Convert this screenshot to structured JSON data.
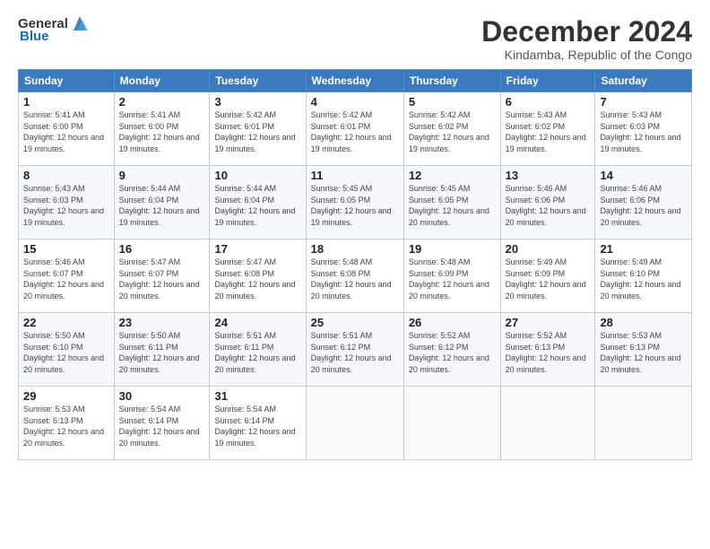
{
  "logo": {
    "general": "General",
    "blue": "Blue"
  },
  "title": "December 2024",
  "location": "Kindamba, Republic of the Congo",
  "days_of_week": [
    "Sunday",
    "Monday",
    "Tuesday",
    "Wednesday",
    "Thursday",
    "Friday",
    "Saturday"
  ],
  "weeks": [
    [
      {
        "day": "1",
        "sunrise": "Sunrise: 5:41 AM",
        "sunset": "Sunset: 6:00 PM",
        "daylight": "Daylight: 12 hours and 19 minutes."
      },
      {
        "day": "2",
        "sunrise": "Sunrise: 5:41 AM",
        "sunset": "Sunset: 6:00 PM",
        "daylight": "Daylight: 12 hours and 19 minutes."
      },
      {
        "day": "3",
        "sunrise": "Sunrise: 5:42 AM",
        "sunset": "Sunset: 6:01 PM",
        "daylight": "Daylight: 12 hours and 19 minutes."
      },
      {
        "day": "4",
        "sunrise": "Sunrise: 5:42 AM",
        "sunset": "Sunset: 6:01 PM",
        "daylight": "Daylight: 12 hours and 19 minutes."
      },
      {
        "day": "5",
        "sunrise": "Sunrise: 5:42 AM",
        "sunset": "Sunset: 6:02 PM",
        "daylight": "Daylight: 12 hours and 19 minutes."
      },
      {
        "day": "6",
        "sunrise": "Sunrise: 5:43 AM",
        "sunset": "Sunset: 6:02 PM",
        "daylight": "Daylight: 12 hours and 19 minutes."
      },
      {
        "day": "7",
        "sunrise": "Sunrise: 5:43 AM",
        "sunset": "Sunset: 6:03 PM",
        "daylight": "Daylight: 12 hours and 19 minutes."
      }
    ],
    [
      {
        "day": "8",
        "sunrise": "Sunrise: 5:43 AM",
        "sunset": "Sunset: 6:03 PM",
        "daylight": "Daylight: 12 hours and 19 minutes."
      },
      {
        "day": "9",
        "sunrise": "Sunrise: 5:44 AM",
        "sunset": "Sunset: 6:04 PM",
        "daylight": "Daylight: 12 hours and 19 minutes."
      },
      {
        "day": "10",
        "sunrise": "Sunrise: 5:44 AM",
        "sunset": "Sunset: 6:04 PM",
        "daylight": "Daylight: 12 hours and 19 minutes."
      },
      {
        "day": "11",
        "sunrise": "Sunrise: 5:45 AM",
        "sunset": "Sunset: 6:05 PM",
        "daylight": "Daylight: 12 hours and 19 minutes."
      },
      {
        "day": "12",
        "sunrise": "Sunrise: 5:45 AM",
        "sunset": "Sunset: 6:05 PM",
        "daylight": "Daylight: 12 hours and 20 minutes."
      },
      {
        "day": "13",
        "sunrise": "Sunrise: 5:46 AM",
        "sunset": "Sunset: 6:06 PM",
        "daylight": "Daylight: 12 hours and 20 minutes."
      },
      {
        "day": "14",
        "sunrise": "Sunrise: 5:46 AM",
        "sunset": "Sunset: 6:06 PM",
        "daylight": "Daylight: 12 hours and 20 minutes."
      }
    ],
    [
      {
        "day": "15",
        "sunrise": "Sunrise: 5:46 AM",
        "sunset": "Sunset: 6:07 PM",
        "daylight": "Daylight: 12 hours and 20 minutes."
      },
      {
        "day": "16",
        "sunrise": "Sunrise: 5:47 AM",
        "sunset": "Sunset: 6:07 PM",
        "daylight": "Daylight: 12 hours and 20 minutes."
      },
      {
        "day": "17",
        "sunrise": "Sunrise: 5:47 AM",
        "sunset": "Sunset: 6:08 PM",
        "daylight": "Daylight: 12 hours and 20 minutes."
      },
      {
        "day": "18",
        "sunrise": "Sunrise: 5:48 AM",
        "sunset": "Sunset: 6:08 PM",
        "daylight": "Daylight: 12 hours and 20 minutes."
      },
      {
        "day": "19",
        "sunrise": "Sunrise: 5:48 AM",
        "sunset": "Sunset: 6:09 PM",
        "daylight": "Daylight: 12 hours and 20 minutes."
      },
      {
        "day": "20",
        "sunrise": "Sunrise: 5:49 AM",
        "sunset": "Sunset: 6:09 PM",
        "daylight": "Daylight: 12 hours and 20 minutes."
      },
      {
        "day": "21",
        "sunrise": "Sunrise: 5:49 AM",
        "sunset": "Sunset: 6:10 PM",
        "daylight": "Daylight: 12 hours and 20 minutes."
      }
    ],
    [
      {
        "day": "22",
        "sunrise": "Sunrise: 5:50 AM",
        "sunset": "Sunset: 6:10 PM",
        "daylight": "Daylight: 12 hours and 20 minutes."
      },
      {
        "day": "23",
        "sunrise": "Sunrise: 5:50 AM",
        "sunset": "Sunset: 6:11 PM",
        "daylight": "Daylight: 12 hours and 20 minutes."
      },
      {
        "day": "24",
        "sunrise": "Sunrise: 5:51 AM",
        "sunset": "Sunset: 6:11 PM",
        "daylight": "Daylight: 12 hours and 20 minutes."
      },
      {
        "day": "25",
        "sunrise": "Sunrise: 5:51 AM",
        "sunset": "Sunset: 6:12 PM",
        "daylight": "Daylight: 12 hours and 20 minutes."
      },
      {
        "day": "26",
        "sunrise": "Sunrise: 5:52 AM",
        "sunset": "Sunset: 6:12 PM",
        "daylight": "Daylight: 12 hours and 20 minutes."
      },
      {
        "day": "27",
        "sunrise": "Sunrise: 5:52 AM",
        "sunset": "Sunset: 6:13 PM",
        "daylight": "Daylight: 12 hours and 20 minutes."
      },
      {
        "day": "28",
        "sunrise": "Sunrise: 5:53 AM",
        "sunset": "Sunset: 6:13 PM",
        "daylight": "Daylight: 12 hours and 20 minutes."
      }
    ],
    [
      {
        "day": "29",
        "sunrise": "Sunrise: 5:53 AM",
        "sunset": "Sunset: 6:13 PM",
        "daylight": "Daylight: 12 hours and 20 minutes."
      },
      {
        "day": "30",
        "sunrise": "Sunrise: 5:54 AM",
        "sunset": "Sunset: 6:14 PM",
        "daylight": "Daylight: 12 hours and 20 minutes."
      },
      {
        "day": "31",
        "sunrise": "Sunrise: 5:54 AM",
        "sunset": "Sunset: 6:14 PM",
        "daylight": "Daylight: 12 hours and 19 minutes."
      },
      null,
      null,
      null,
      null
    ]
  ]
}
